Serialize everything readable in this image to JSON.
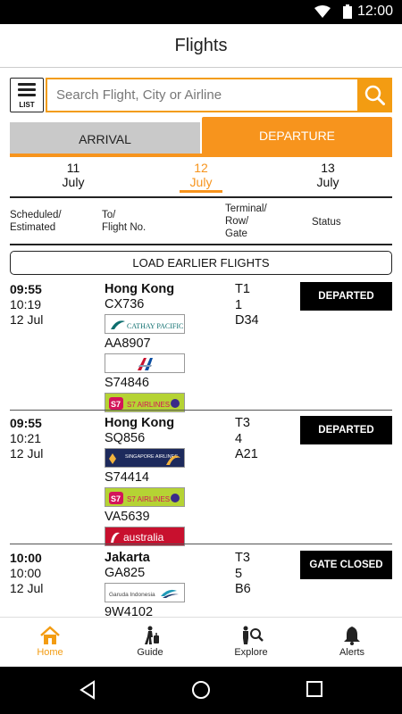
{
  "status_bar": {
    "time": "12:00"
  },
  "header": {
    "title": "Flights"
  },
  "toolbar": {
    "list_label": "LIST"
  },
  "search": {
    "placeholder": "Search Flight, City or Airline"
  },
  "tabs": {
    "arrival": "ARRIVAL",
    "departure": "DEPARTURE",
    "active": "departure"
  },
  "dates": [
    {
      "day": "11",
      "month": "July"
    },
    {
      "day": "12",
      "month": "July",
      "selected": true
    },
    {
      "day": "13",
      "month": "July"
    }
  ],
  "columns": {
    "scheduled_l1": "Scheduled/",
    "scheduled_l2": "Estimated",
    "to_l1": "To/",
    "to_l2": "Flight No.",
    "term_l1": "Terminal/",
    "term_l2": "Row/",
    "term_l3": "Gate",
    "status": "Status"
  },
  "load_earlier": "LOAD EARLIER FLIGHTS",
  "flights": [
    {
      "scheduled": "09:55",
      "estimated": "10:19",
      "date": "12 Jul",
      "city": "Hong Kong",
      "flight_no": "CX736",
      "airline_logo": "cathay-pacific",
      "codeshares": [
        {
          "flight_no": "AA8907",
          "airline_logo": "american-airlines"
        },
        {
          "flight_no": "S74846",
          "airline_logo": "s7-airlines"
        }
      ],
      "terminal": "T1",
      "row": "1",
      "gate": "D34",
      "status": "DEPARTED"
    },
    {
      "scheduled": "09:55",
      "estimated": "10:21",
      "date": "12 Jul",
      "city": "Hong Kong",
      "flight_no": "SQ856",
      "airline_logo": "singapore-airlines",
      "codeshares": [
        {
          "flight_no": "S74414",
          "airline_logo": "s7-airlines"
        },
        {
          "flight_no": "VA5639",
          "airline_logo": "virgin-australia"
        }
      ],
      "terminal": "T3",
      "row": "4",
      "gate": "A21",
      "status": "DEPARTED"
    },
    {
      "scheduled": "10:00",
      "estimated": "10:00",
      "date": "12 Jul",
      "city": "Jakarta",
      "flight_no": "GA825",
      "airline_logo": "garuda-indonesia",
      "codeshares": [
        {
          "flight_no": "9W4102",
          "airline_logo": ""
        }
      ],
      "terminal": "T3",
      "row": "5",
      "gate": "B6",
      "status": "GATE CLOSED"
    }
  ],
  "logos": {
    "cathay": "CATHAY PACIFIC",
    "s7": "S7 AIRLINES",
    "singapore": "SINGAPORE AIRLINES",
    "virgin": "australia",
    "garuda": "Garuda Indonesia"
  },
  "bottom_nav": [
    {
      "label": "Home",
      "icon": "home-icon",
      "active": true
    },
    {
      "label": "Guide",
      "icon": "traveler-luggage-icon"
    },
    {
      "label": "Explore",
      "icon": "explore-search-icon"
    },
    {
      "label": "Alerts",
      "icon": "bell-icon"
    }
  ],
  "colors": {
    "accent": "#f7941d",
    "tab_inactive": "#c9c9c9",
    "status_bg": "#000000"
  }
}
